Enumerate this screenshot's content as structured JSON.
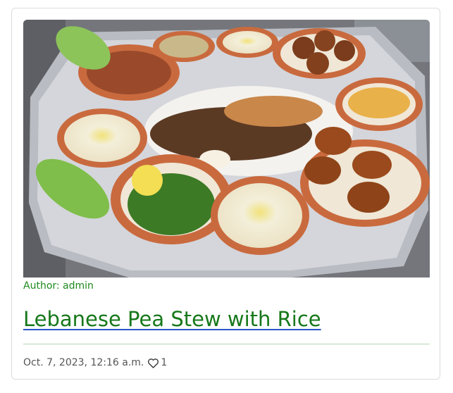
{
  "post": {
    "author_label": "Author: admin",
    "title": "Lebanese Pea Stew with Rice",
    "date": "Oct. 7, 2023, 12:16 a.m.",
    "likes": "1",
    "like_icon": "heart-outline-icon"
  },
  "colors": {
    "author_text": "#1e8a1e",
    "title_text": "#16781a",
    "title_underline": "#2456c8",
    "divider": "#b6d8b6",
    "meta_text": "#555555"
  }
}
